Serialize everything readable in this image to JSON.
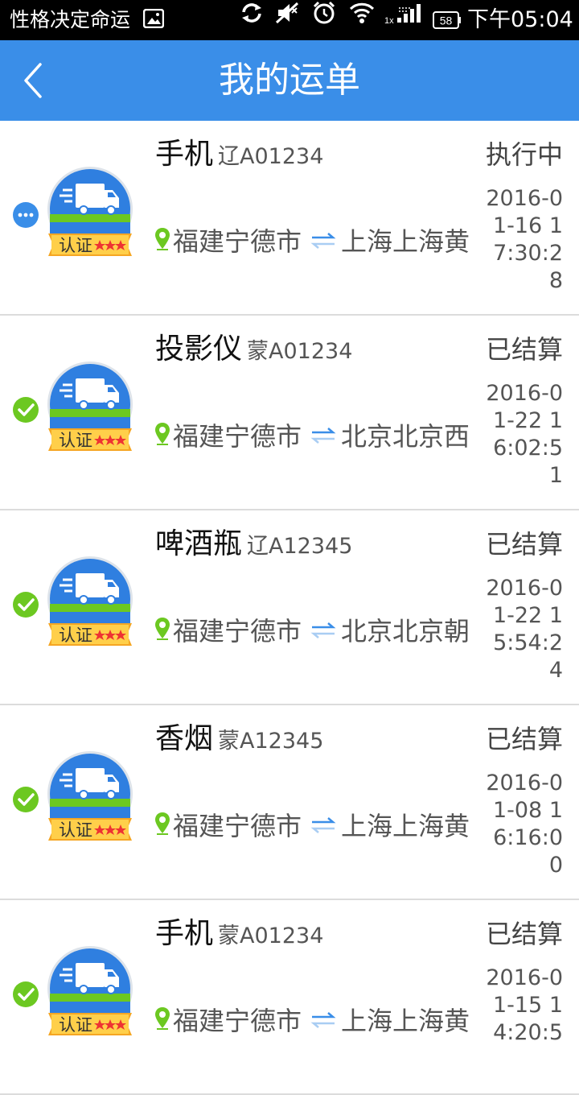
{
  "status_bar": {
    "carrier": "性格决定命运",
    "battery": "58",
    "time": "下午05:04",
    "network_label": "1x",
    "icons": [
      "image-icon",
      "sync-icon",
      "mute-icon",
      "alarm-icon",
      "wifi-icon",
      "signal-icon",
      "battery-icon"
    ]
  },
  "header": {
    "back_icon": "chevron-left-icon",
    "title": "我的运单"
  },
  "colors": {
    "header_bg": "#3a8ee8",
    "status_blue": "#3a8ee8",
    "status_green": "#6cc821",
    "badge_orange": "#f5a623"
  },
  "badge_label": "认证",
  "orders": [
    {
      "cargo": "手机",
      "plate": "辽A01234",
      "status": "执行中",
      "status_icon": "more-dots-icon",
      "from": "福建宁德市",
      "to": "上海上海黄",
      "date": "2016-01-16 17:30:28"
    },
    {
      "cargo": "投影仪",
      "plate": "蒙A01234",
      "status": "已结算",
      "status_icon": "check-circle-icon",
      "from": "福建宁德市",
      "to": "北京北京西",
      "date": "2016-01-22 16:02:51"
    },
    {
      "cargo": "啤酒瓶",
      "plate": "辽A12345",
      "status": "已结算",
      "status_icon": "check-circle-icon",
      "from": "福建宁德市",
      "to": "北京北京朝",
      "date": "2016-01-22 15:54:24"
    },
    {
      "cargo": "香烟",
      "plate": "蒙A12345",
      "status": "已结算",
      "status_icon": "check-circle-icon",
      "from": "福建宁德市",
      "to": "上海上海黄",
      "date": "2016-01-08 16:16:00"
    },
    {
      "cargo": "手机",
      "plate": "蒙A01234",
      "status": "已结算",
      "status_icon": "check-circle-icon",
      "from": "福建宁德市",
      "to": "上海上海黄",
      "date": "2016-01-15 14:20:5"
    }
  ]
}
